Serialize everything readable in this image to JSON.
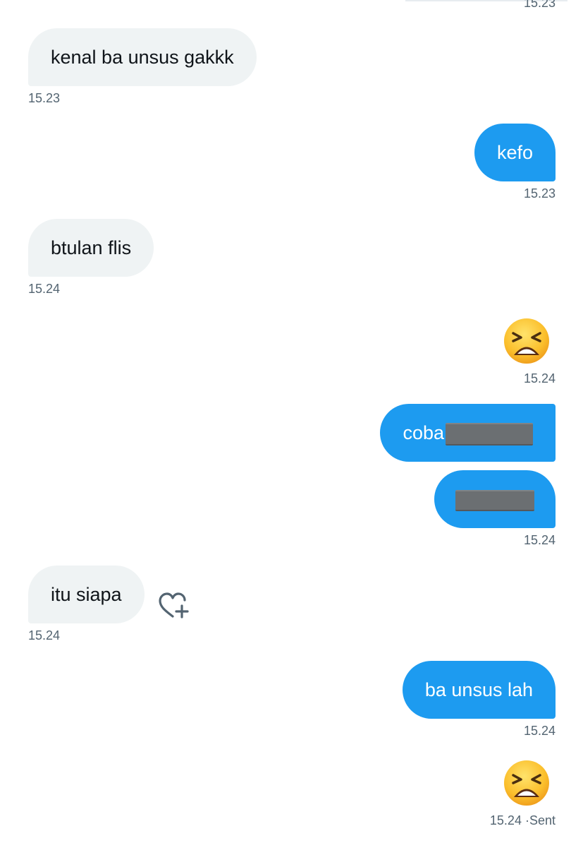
{
  "messages": [
    {
      "id": "m0",
      "timestamp": "15.23"
    },
    {
      "id": "m1",
      "direction": "received",
      "text": "kenal ba unsus gakkk",
      "timestamp": "15.23"
    },
    {
      "id": "m2",
      "direction": "sent",
      "text": "kefo",
      "timestamp": "15.23"
    },
    {
      "id": "m3",
      "direction": "received",
      "text": "btulan flis",
      "timestamp": "15.24"
    },
    {
      "id": "m4",
      "direction": "sent",
      "emoji": "tired-face",
      "timestamp": "15.24"
    },
    {
      "id": "m5",
      "direction": "sent",
      "text": "coba",
      "redacted": true
    },
    {
      "id": "m6",
      "direction": "sent",
      "redacted": true,
      "timestamp": "15.24"
    },
    {
      "id": "m7",
      "direction": "received",
      "text": "itu siapa",
      "timestamp": "15.24",
      "reaction_button": "heart-plus-icon"
    },
    {
      "id": "m8",
      "direction": "sent",
      "text": "ba unsus lah",
      "timestamp": "15.24"
    },
    {
      "id": "m9",
      "direction": "sent",
      "emoji": "tired-face",
      "timestamp": "15.24",
      "status": "Sent"
    }
  ],
  "status_separator": "·",
  "colors": {
    "sent_bubble": "#1d9bf0",
    "received_bubble": "#eff3f4",
    "received_text": "#0f1419",
    "timestamp": "#536471",
    "redaction": "#6b6f72"
  }
}
